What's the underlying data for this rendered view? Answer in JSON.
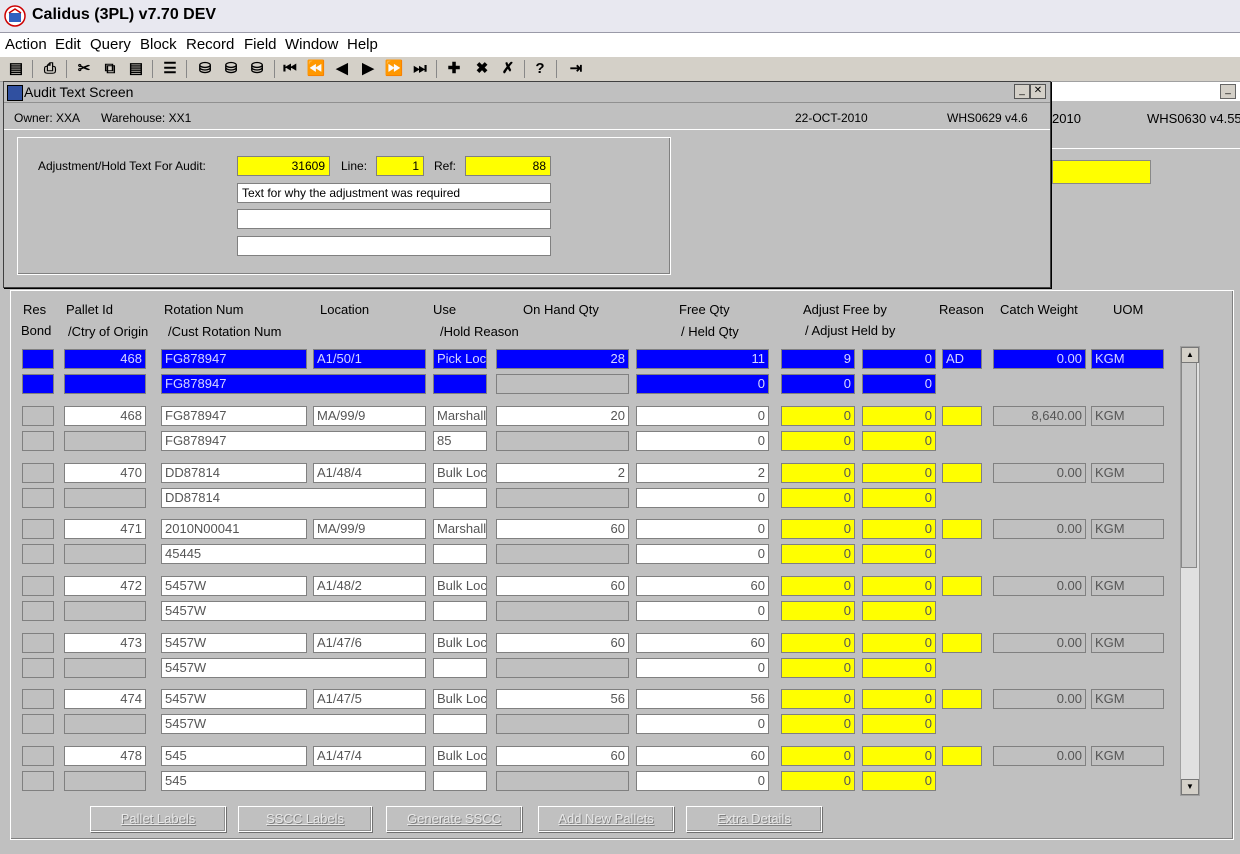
{
  "app": {
    "title": "Calidus (3PL) v7.70 DEV"
  },
  "menu": [
    "Action",
    "Edit",
    "Query",
    "Block",
    "Record",
    "Field",
    "Window",
    "Help"
  ],
  "toolbar": {
    "icons": [
      "save-icon",
      "print-icon",
      "cut-icon",
      "copy-icon",
      "paste-icon",
      "list-icon",
      "db1-icon",
      "db2-icon",
      "db3-icon",
      "first-record-icon",
      "prev-page-icon",
      "prev-record-icon",
      "next-record-icon",
      "next-page-icon",
      "last-record-icon",
      "insert-record-icon",
      "delete-record-icon",
      "clear-record-icon",
      "help-icon",
      "exit-icon"
    ]
  },
  "background_window": {
    "date_partial": "2010",
    "code": "WHS0630  v4.55"
  },
  "audit": {
    "title": "Audit Text Screen",
    "owner": "Owner:  XXA",
    "warehouse": "Warehouse:  XX1",
    "date": "22-OCT-2010",
    "code": "WHS0629  v4.6",
    "label_text": "Adjustment/Hold Text For Audit:",
    "id_value": "31609",
    "label_line": "Line:",
    "line_value": "1",
    "label_ref": "Ref:",
    "ref_value": "88",
    "text_lines": [
      "Text for why the adjustment was required",
      "",
      ""
    ]
  },
  "columns": {
    "res": "Res",
    "bond": "Bond",
    "pallet": "Pallet Id",
    "ctry": "/Ctry of Origin",
    "rotation": "Rotation Num",
    "cust_rotation": "/Cust Rotation Num",
    "location": "Location",
    "use": "Use",
    "hold_reason": "/Hold Reason",
    "onhand": "On Hand Qty",
    "free": "Free Qty",
    "held": "/ Held Qty",
    "adjust_free": "Adjust Free by",
    "adjust_held": "/ Adjust Held by",
    "reason": "Reason",
    "catch": "Catch Weight",
    "uom": "UOM"
  },
  "rows": [
    {
      "pallet": "468",
      "rotation": "FG878947",
      "location": "A1/50/1",
      "use": "Pick Loc",
      "onhand": "28",
      "free": "11",
      "adj_free": "9",
      "adj_extra": "0",
      "reason": "AD",
      "catch": "0.00",
      "uom": "KGM",
      "cust_rotation": "FG878947",
      "hold_reason": "",
      "held": "0",
      "adj_held": "0",
      "adj_held_extra": "0",
      "selected": true
    },
    {
      "pallet": "468",
      "rotation": "FG878947",
      "location": "MA/99/9",
      "use": "Marshall",
      "onhand": "20",
      "free": "0",
      "adj_free": "0",
      "adj_extra": "0",
      "reason": "",
      "catch": "8,640.00",
      "uom": "KGM",
      "cust_rotation": "FG878947",
      "hold_reason": "85",
      "held": "0",
      "adj_held": "0",
      "adj_held_extra": "0"
    },
    {
      "pallet": "470",
      "rotation": "DD87814",
      "location": "A1/48/4",
      "use": "Bulk Loc",
      "onhand": "2",
      "free": "2",
      "adj_free": "0",
      "adj_extra": "0",
      "reason": "",
      "catch": "0.00",
      "uom": "KGM",
      "cust_rotation": "DD87814",
      "hold_reason": "",
      "held": "0",
      "adj_held": "0",
      "adj_held_extra": "0"
    },
    {
      "pallet": "471",
      "rotation": "2010N00041",
      "location": "MA/99/9",
      "use": "Marshall",
      "onhand": "60",
      "free": "0",
      "adj_free": "0",
      "adj_extra": "0",
      "reason": "",
      "catch": "0.00",
      "uom": "KGM",
      "cust_rotation": "45445",
      "hold_reason": "",
      "held": "0",
      "adj_held": "0",
      "adj_held_extra": "0"
    },
    {
      "pallet": "472",
      "rotation": "5457W",
      "location": "A1/48/2",
      "use": "Bulk Loc",
      "onhand": "60",
      "free": "60",
      "adj_free": "0",
      "adj_extra": "0",
      "reason": "",
      "catch": "0.00",
      "uom": "KGM",
      "cust_rotation": "5457W",
      "hold_reason": "",
      "held": "0",
      "adj_held": "0",
      "adj_held_extra": "0"
    },
    {
      "pallet": "473",
      "rotation": "5457W",
      "location": "A1/47/6",
      "use": "Bulk Loc",
      "onhand": "60",
      "free": "60",
      "adj_free": "0",
      "adj_extra": "0",
      "reason": "",
      "catch": "0.00",
      "uom": "KGM",
      "cust_rotation": "5457W",
      "hold_reason": "",
      "held": "0",
      "adj_held": "0",
      "adj_held_extra": "0"
    },
    {
      "pallet": "474",
      "rotation": "5457W",
      "location": "A1/47/5",
      "use": "Bulk Loc",
      "onhand": "56",
      "free": "56",
      "adj_free": "0",
      "adj_extra": "0",
      "reason": "",
      "catch": "0.00",
      "uom": "KGM",
      "cust_rotation": "5457W",
      "hold_reason": "",
      "held": "0",
      "adj_held": "0",
      "adj_held_extra": "0"
    },
    {
      "pallet": "478",
      "rotation": "545",
      "location": "A1/47/4",
      "use": "Bulk Loc",
      "onhand": "60",
      "free": "60",
      "adj_free": "0",
      "adj_extra": "0",
      "reason": "",
      "catch": "0.00",
      "uom": "KGM",
      "cust_rotation": "545",
      "hold_reason": "",
      "held": "0",
      "adj_held": "0",
      "adj_held_extra": "0"
    }
  ],
  "buttons": [
    "Pallet Labels",
    "SSCC Labels",
    "Generate SSCC",
    "Add New Pallets",
    "Extra Details"
  ],
  "colors": {
    "highlight": "#0000ff",
    "mandatory": "#ffff00",
    "background": "#c0c0c0"
  }
}
